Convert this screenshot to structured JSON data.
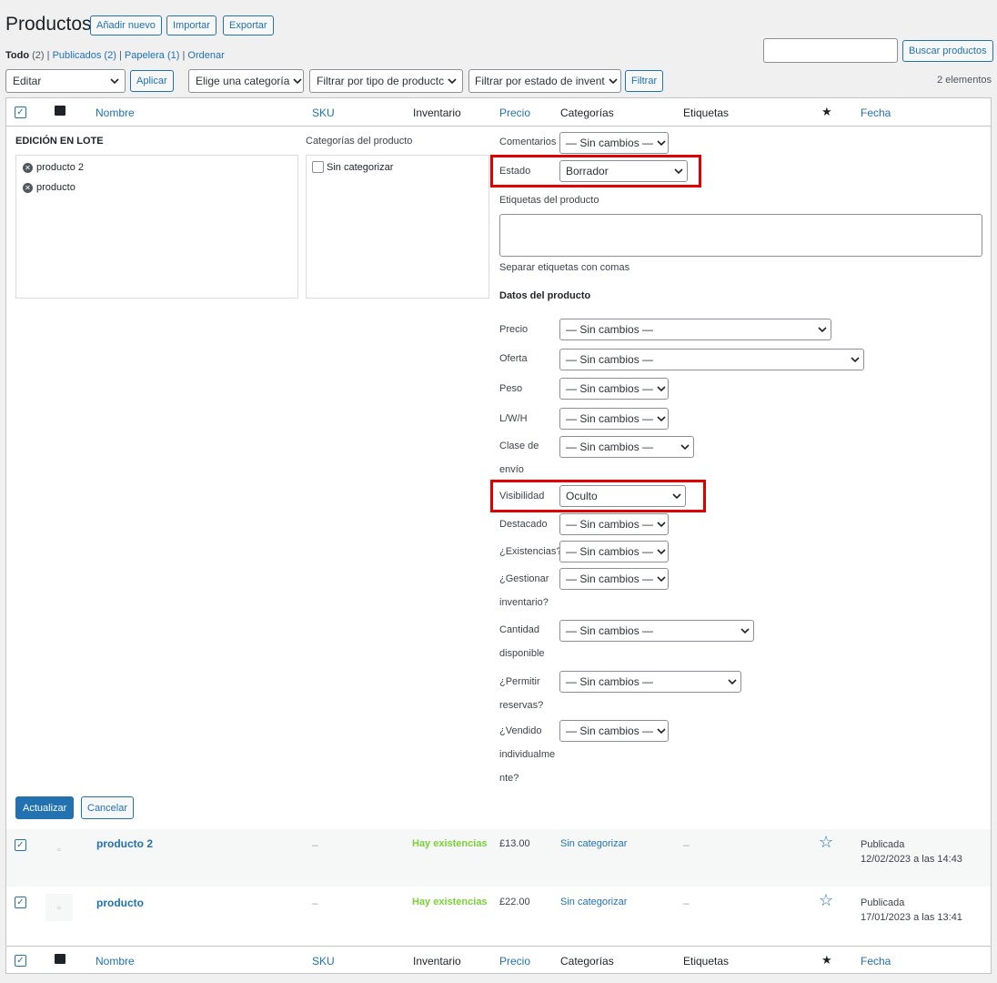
{
  "header": {
    "title": "Productos",
    "add_new": "Añadir nuevo",
    "import": "Importar",
    "export": "Exportar"
  },
  "filters_links": {
    "all": "Todo",
    "all_count": "(2)",
    "published": "Publicados (2)",
    "trash": "Papelera (1)",
    "sort": "Ordenar",
    "sep": "|"
  },
  "search": {
    "button": "Buscar productos",
    "value": ""
  },
  "toolbar": {
    "bulk_action": "Editar",
    "apply": "Aplicar",
    "category": "Elige una categoría",
    "product_type": "Filtrar por tipo de productc",
    "stock_status": "Filtrar por estado de invent",
    "filter": "Filtrar",
    "count": "2 elementos"
  },
  "columns": {
    "name": "Nombre",
    "sku": "SKU",
    "stock": "Inventario",
    "price": "Precio",
    "categories": "Categorías",
    "tags": "Etiquetas",
    "featured": "★",
    "date": "Fecha"
  },
  "bulk": {
    "title": "EDICIÓN EN LOTE",
    "items": [
      "producto 2",
      "producto"
    ],
    "categories_title": "Categorías del producto",
    "categories": [
      "Sin categorizar"
    ],
    "comments_label": "Comentarios",
    "comments_value": "— Sin cambios —",
    "status_label": "Estado",
    "status_value": "Borrador",
    "tags_label": "Etiquetas del producto",
    "tags_hint": "Separar etiquetas con comas",
    "product_data_title": "Datos del producto",
    "fields": [
      {
        "label": "Precio",
        "value": "— Sin cambios —"
      },
      {
        "label": "Oferta",
        "value": "— Sin cambios —"
      },
      {
        "label": "Peso",
        "value": "— Sin cambios —"
      },
      {
        "label": "L/W/H",
        "value": "— Sin cambios —"
      },
      {
        "label1": "Clase de",
        "label2": "envío",
        "value": "— Sin cambios —"
      },
      {
        "label": "Visibilidad",
        "value": "Oculto"
      },
      {
        "label": "Destacado",
        "value": "— Sin cambios —"
      },
      {
        "label": "¿Existencias?",
        "value": "— Sin cambios —"
      },
      {
        "label1": "¿Gestionar",
        "label2": "inventario?",
        "value": "— Sin cambios —"
      },
      {
        "label1": "Cantidad",
        "label2": "disponible",
        "value": "— Sin cambios —"
      },
      {
        "label1": "¿Permitir",
        "label2": "reservas?",
        "value": "— Sin cambios —"
      },
      {
        "label1": "¿Vendido",
        "label2": "individualme",
        "label3": "nte?",
        "value": "— Sin cambios —"
      }
    ],
    "update": "Actualizar",
    "cancel": "Cancelar"
  },
  "rows": [
    {
      "name": "producto 2",
      "sku": "–",
      "stock": "Hay existencias",
      "price": "£13.00",
      "category": "Sin categorizar",
      "tags": "–",
      "status": "Publicada",
      "date": "12/02/2023 a las 14:43"
    },
    {
      "name": "producto",
      "sku": "–",
      "stock": "Hay existencias",
      "price": "£22.00",
      "category": "Sin categorizar",
      "tags": "–",
      "status": "Publicada",
      "date": "17/01/2023 a las 13:41"
    }
  ],
  "colors": {
    "accent": "#2271b1",
    "highlight": "#e00000",
    "stock": "#7ad03a"
  }
}
